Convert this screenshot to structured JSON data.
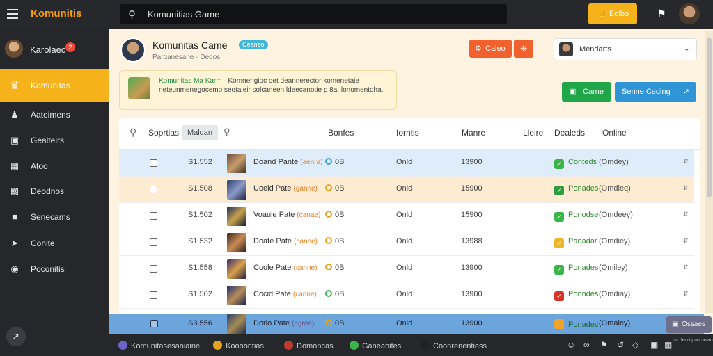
{
  "app": {
    "logo": "Komunitis"
  },
  "search": {
    "value": "Komunitias Game"
  },
  "topbar": {
    "button_label": "Eolbo"
  },
  "sidebar": {
    "user": {
      "name": "Karolaec",
      "badge": "2"
    },
    "items": [
      {
        "label": "Komunitas",
        "icon": "game-icon",
        "active": true
      },
      {
        "label": "Aateimens",
        "icon": "people-icon"
      },
      {
        "label": "Gealteirs",
        "icon": "briefcase-icon"
      },
      {
        "label": "Atoo",
        "icon": "grid-icon"
      },
      {
        "label": "Deodnos",
        "icon": "calendar-icon"
      },
      {
        "label": "Senecams",
        "icon": "image-icon"
      },
      {
        "label": "Conite",
        "icon": "megaphone-icon"
      },
      {
        "label": "Poconitis",
        "icon": "pin-icon"
      }
    ]
  },
  "header": {
    "title": "Komunitas Came",
    "tag": "Ceaneo",
    "meta": "Parganesane · Deoos",
    "action_label": "Caleo",
    "select_label": "Mendarts"
  },
  "banner": {
    "title": "Komunitas Ma Karm",
    "text": "· Komnerigioc oet deannerector komenetaie neteunmenegocemo seotaleir solcaneen ldeecanotie p 8a. lonomentoha."
  },
  "buttons": {
    "green_label": "Carne",
    "blue_label": "Senne Ceding"
  },
  "table": {
    "filter_chip": "Maldan",
    "headers": [
      "Soprtias",
      "Bonfes",
      "Iorntis",
      "Manre",
      "Lleire",
      "Dealeds",
      "Online"
    ],
    "rows": [
      {
        "num": "S1.552",
        "name": "Doand Pante",
        "tag": "(aenra)",
        "stat": "0B",
        "stat_color": "#3aa0d8",
        "c3": "Onld",
        "c4": "13900",
        "status": "Conteds",
        "status_color": "#3bb54a",
        "online": "(Omdey)",
        "state": "blue",
        "thumb": "linear-gradient(135deg,#6a4c3a,#c59e6e 50%,#3b2a20)"
      },
      {
        "num": "S1.508",
        "name": "Uoeld Pate",
        "tag": "(ganne)",
        "stat": "0B",
        "stat_color": "#e4a320",
        "c3": "Onld",
        "c4": "15900",
        "status": "Ponades",
        "status_color": "#2d9b3f",
        "online": "(Omdieq)",
        "state": "orange",
        "thumb": "linear-gradient(135deg,#2c3e6b,#8b9ac8 50%,#1e2440)"
      },
      {
        "num": "S1.502",
        "name": "Voaule Pate",
        "tag": "(canae)",
        "stat": "0B",
        "stat_color": "#e4a320",
        "c3": "Onld",
        "c4": "15900",
        "status": "Ponodse",
        "status_color": "#3bb54a",
        "online": "(Omdeey)",
        "state": "",
        "thumb": "linear-gradient(135deg,#1c2b5a,#c7a24b 50%,#0f1a33)"
      },
      {
        "num": "S1.532",
        "name": "Doate Pate",
        "tag": "(canne)",
        "stat": "0B",
        "stat_color": "#e4a320",
        "c3": "Onld",
        "c4": "13988",
        "status": "Panadar",
        "status_color": "#f0b429",
        "online": "(Omdiey)",
        "state": "",
        "thumb": "linear-gradient(135deg,#3a2418,#c98b57 50%,#2a1a12)"
      },
      {
        "num": "S1.558",
        "name": "Coole Pate",
        "tag": "(canne)",
        "stat": "0B",
        "stat_color": "#e4a320",
        "c3": "Onld",
        "c4": "13900",
        "status": "Ponades",
        "status_color": "#3bb54a",
        "online": "(Omiley)",
        "state": "",
        "thumb": "linear-gradient(135deg,#3a2a6b,#d9a14a 50%,#231a44)"
      },
      {
        "num": "S1.502",
        "name": "Cocid Pate",
        "tag": "(canne)",
        "stat": "0B",
        "stat_color": "#3bb54a",
        "c3": "Onld",
        "c4": "13900",
        "status": "Ponndes",
        "status_color": "#d9342b",
        "online": "(Omdiay)",
        "state": "",
        "thumb": "linear-gradient(135deg,#1f2f6e,#b98d5a 50%,#15204a)"
      }
    ],
    "bottom_row": {
      "num": "S3.556",
      "name": "Dorio Pate",
      "tag": "(egrea)",
      "stat": "0B",
      "c3": "Onld",
      "c4": "13900",
      "status": "Ponadec",
      "online": "(Omaley)"
    }
  },
  "float_button": {
    "label": "Ossaes"
  },
  "footer": {
    "items": [
      {
        "label": "Komunitasesaniaine",
        "icon_color": "#6c63c9"
      },
      {
        "label": "Koooontias",
        "icon_color": "#e4a320"
      },
      {
        "label": "Domoncas",
        "icon_color": "#c0392b"
      },
      {
        "label": "Ganeanites",
        "icon_color": "#3bb54a"
      },
      {
        "label": "Coonrenentiess",
        "icon_color": "#222"
      }
    ],
    "tiny": "ba decrt pancasan"
  }
}
